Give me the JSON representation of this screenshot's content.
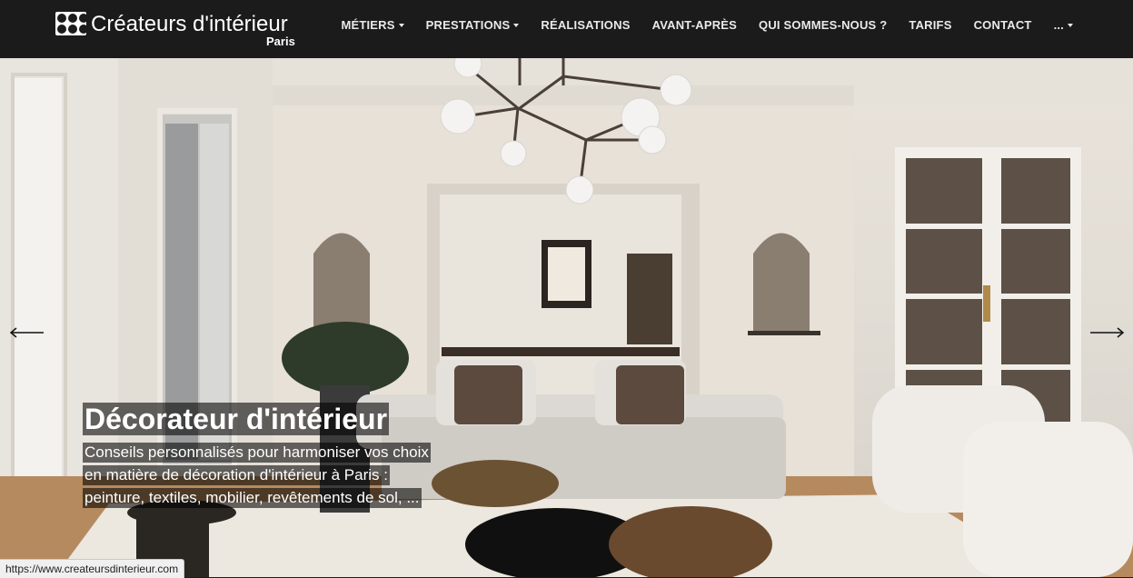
{
  "header": {
    "logo_text": "Créateurs d'intérieur",
    "logo_sub": "Paris",
    "nav": [
      {
        "label": "MÉTIERS",
        "dropdown": true
      },
      {
        "label": "PRESTATIONS",
        "dropdown": true
      },
      {
        "label": "RÉALISATIONS",
        "dropdown": false
      },
      {
        "label": "AVANT-APRÈS",
        "dropdown": false
      },
      {
        "label": "QUI SOMMES-NOUS ?",
        "dropdown": false
      },
      {
        "label": "TARIFS",
        "dropdown": false
      },
      {
        "label": "CONTACT",
        "dropdown": false
      },
      {
        "label": "...",
        "dropdown": true
      }
    ]
  },
  "hero": {
    "title": "Décorateur d'intérieur",
    "lines": [
      "Conseils personnalisés pour harmoniser vos choix",
      "en matière de décoration d'intérieur à Paris :",
      "peinture, textiles, mobilier, revêtements de sol, ..."
    ],
    "prev_icon": "arrow-left-icon",
    "next_icon": "arrow-right-icon"
  },
  "status": {
    "url": "https://www.createursdinterieur.com"
  },
  "colors": {
    "topbar": "#1b1b1b",
    "nav_text": "#eaeaea",
    "caption_bg": "rgba(0,0,0,0.58)"
  }
}
